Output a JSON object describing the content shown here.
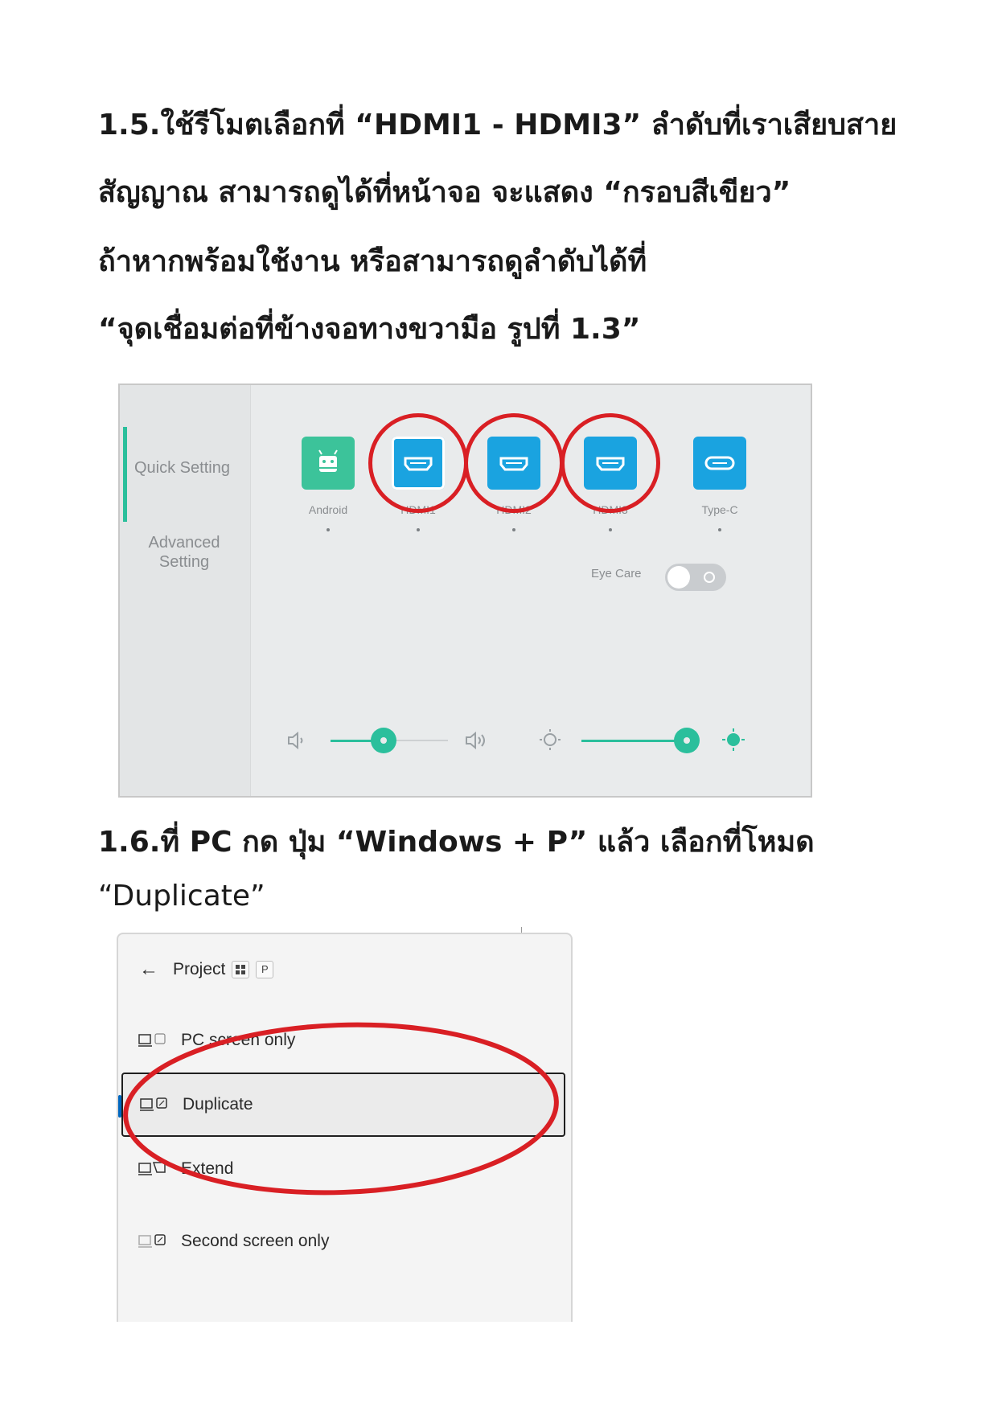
{
  "section_1_5": {
    "lines": [
      "1.5.ใช้รีโมตเลือกที่ “HDMI1 - HDMI3” ลำดับที่เราเสียบสาย",
      "สัญญาณ สามารถดูได้ที่หน้าจอ จะแสดง “กรอบสีเขียว”",
      "ถ้าหากพร้อมใช้งาน หรือสามารถดูลำดับได้ที่",
      "“จุดเชื่อมต่อที่ข้างจอทางขวามือ รูปที่ 1.3”"
    ]
  },
  "quick_setting": {
    "sidebar": {
      "quick_setting": "Quick Setting",
      "advanced_setting": "Advanced Setting"
    },
    "sources": [
      {
        "label": "Android",
        "icon": "android-icon",
        "color": "#3cc39a"
      },
      {
        "label": "HDMI1",
        "icon": "hdmi-icon",
        "color": "#1aa3e0"
      },
      {
        "label": "HDMI2",
        "icon": "hdmi-icon",
        "color": "#1aa3e0"
      },
      {
        "label": "HDMI3",
        "icon": "hdmi-icon",
        "color": "#1aa3e0"
      },
      {
        "label": "Type-C",
        "icon": "usb-c-icon",
        "color": "#1aa3e0"
      }
    ],
    "eye_care": {
      "label": "Eye Care",
      "enabled": false
    },
    "volume": {
      "level": 0.45
    },
    "brightness": {
      "level": 0.97
    },
    "accent_color": "#2bbf9c",
    "highlight_color": "#d91f24"
  },
  "section_1_6": {
    "lines": [
      "1.6.ที่ PC กด ปุ่ม “Windows + P” แล้ว เลือกที่โหมด",
      "“Duplicate”"
    ]
  },
  "project_panel": {
    "title": "Project",
    "shortcut_key": "P",
    "options": [
      {
        "label": "PC screen only",
        "selected": false
      },
      {
        "label": "Duplicate",
        "selected": true
      },
      {
        "label": "Extend",
        "selected": false
      },
      {
        "label": "Second screen only",
        "selected": false
      }
    ]
  }
}
